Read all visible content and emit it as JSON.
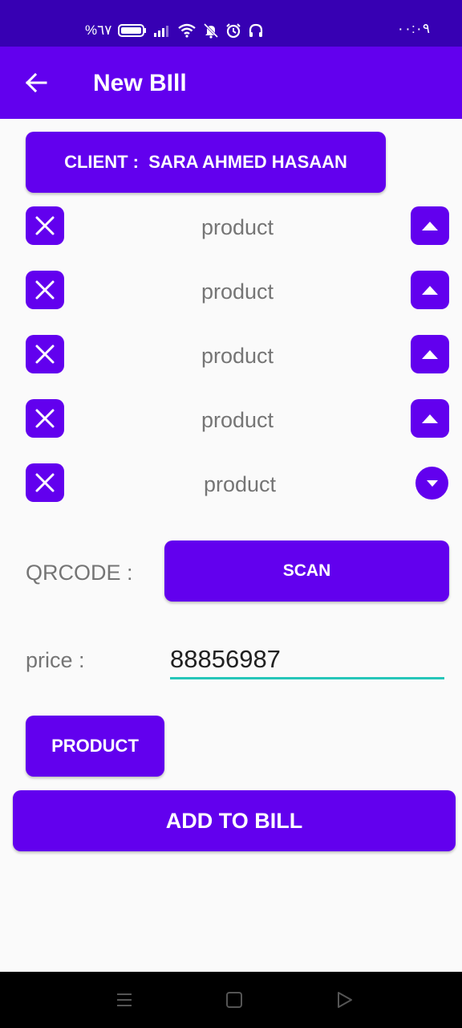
{
  "status_bar": {
    "battery_text": "%٦٧",
    "time": "٠٠:٠٩",
    "icons": [
      "battery-icon",
      "signal-icon",
      "wifi-icon",
      "bell-off-icon",
      "alarm-icon",
      "headphones-icon"
    ]
  },
  "app_bar": {
    "title": "New BIll",
    "back_icon": "arrow-left-icon"
  },
  "client_button": {
    "label": "CLIENT :  SARA AHMED HASAAN"
  },
  "product_rows": [
    {
      "label": "product",
      "expand_state": "up"
    },
    {
      "label": "product",
      "expand_state": "up"
    },
    {
      "label": "product",
      "expand_state": "up"
    },
    {
      "label": "product",
      "expand_state": "up"
    },
    {
      "label": "product",
      "expand_state": "down"
    }
  ],
  "qrcode": {
    "label": "QRCODE :",
    "scan_label": "SCAN"
  },
  "price": {
    "label": "price :",
    "value": "88856987"
  },
  "product_button": {
    "label": "PRODUCT"
  },
  "add_button": {
    "label": "ADD TO BILL"
  },
  "nav_bar": {
    "icons": [
      "menu-icon",
      "home-square-icon",
      "back-triangle-icon"
    ]
  },
  "colors": {
    "primary": "#6200ee",
    "primary_dark": "#3700b3",
    "accent": "#26c6b9",
    "background": "#fafafa",
    "text_secondary": "#757575"
  }
}
